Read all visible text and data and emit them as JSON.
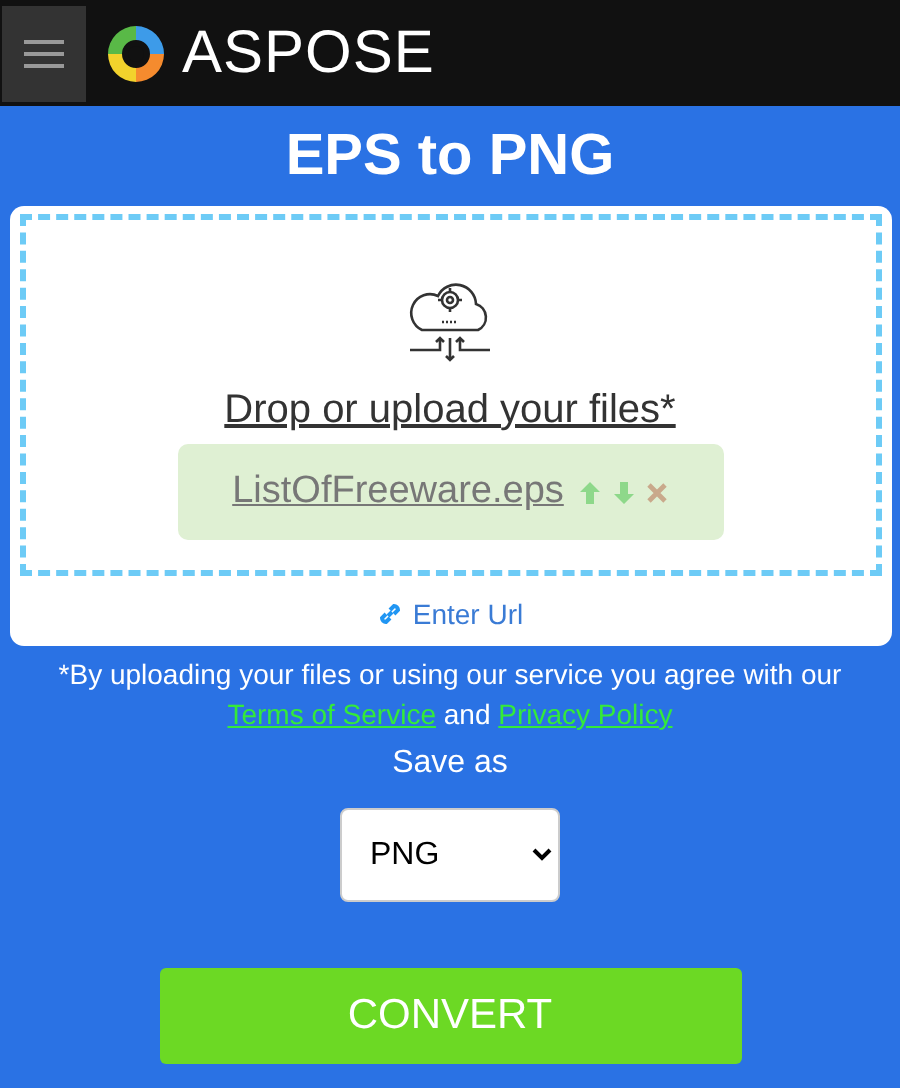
{
  "header": {
    "logo_text": "ASPOSE"
  },
  "title": "EPS to PNG",
  "upload": {
    "prompt": "Drop or upload your files*",
    "files": [
      {
        "name": "ListOfFreeware.eps"
      }
    ],
    "url_link": "Enter Url"
  },
  "consent": {
    "text": "*By uploading your files or using our service you agree with our",
    "terms_link": "Terms of Service",
    "joiner": "and",
    "privacy_link": "Privacy Policy"
  },
  "save_as": {
    "label": "Save as",
    "value": "PNG"
  },
  "convert_button": "CONVERT"
}
